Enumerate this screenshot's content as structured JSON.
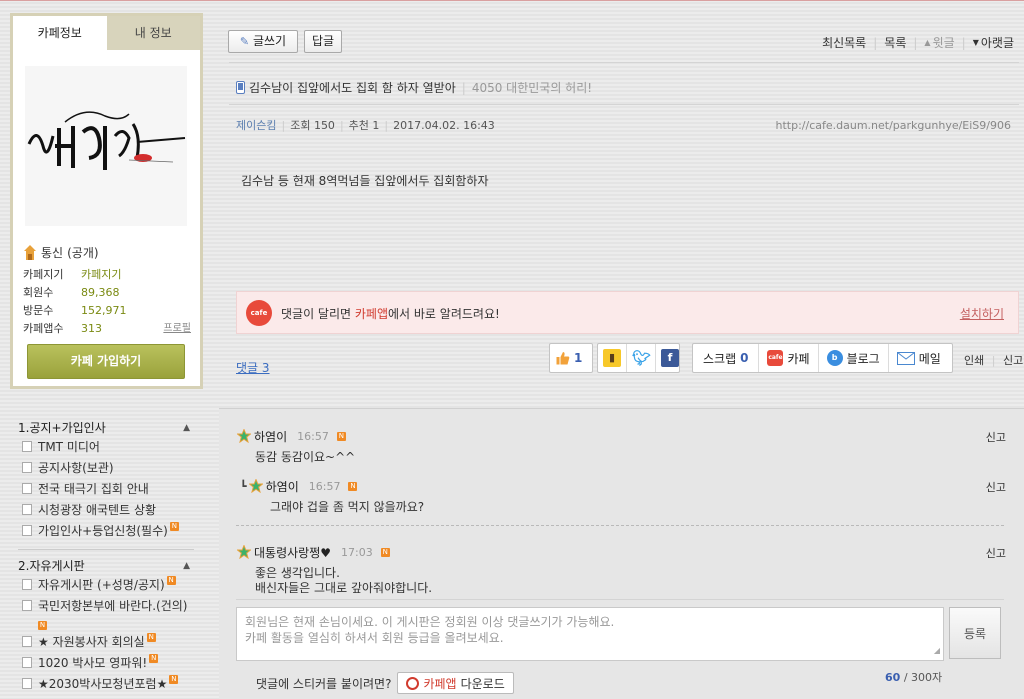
{
  "profile": {
    "tab_active": "카페정보",
    "tab_inactive": "내 정보",
    "level_name": "통신",
    "level_suffix": "(공개)",
    "stats": [
      {
        "key": "카페지기",
        "value": "카페지기"
      },
      {
        "key": "회원수",
        "value": "89,368"
      },
      {
        "key": "방문수",
        "value": "152,971"
      },
      {
        "key": "카페앱수",
        "value": "313",
        "link": "프로필"
      }
    ],
    "join_label": "카페 가입하기"
  },
  "menu": {
    "sections": [
      {
        "title": "1.공지+가입인사",
        "items": [
          {
            "label": "TMT 미디어",
            "new": false
          },
          {
            "label": "공지사항(보관)",
            "new": false
          },
          {
            "label": "전국 태극기 집회 안내",
            "new": false
          },
          {
            "label": "시청광장 애국텐트 상황",
            "new": false
          },
          {
            "label": "가입인사+등업신청(필수)",
            "new": true
          }
        ]
      },
      {
        "title": "2.자유게시판",
        "items": [
          {
            "label": "자유게시판 (+성명/공지)",
            "new": true
          },
          {
            "label": "국민저항본부에 바란다.(건의)",
            "new": true
          },
          {
            "label": "★ 자원봉사자 회의실",
            "new": true
          },
          {
            "label": "1020 박사모 영파워!",
            "new": true
          },
          {
            "label": "★2030박사모청년포럼★",
            "new": true
          }
        ]
      }
    ]
  },
  "toolbar": {
    "write_label": "글쓰기",
    "reply_label": "답글",
    "nav": [
      "최신목록",
      "목록",
      "윗글",
      "아랫글"
    ]
  },
  "post": {
    "title": "김수남이 집앞에서도 집회 함 하자 열받아",
    "board": "4050 대한민국의 허리!",
    "author": "제이슨킴",
    "views": "조회 150",
    "likes": "추천 1",
    "date": "2017.04.02. 16:43",
    "url": "http://cafe.daum.net/parkgunhye/EiS9/906",
    "content": "김수남 등 현재 8역먹넘들 집앞에서두 집회함하자"
  },
  "promo": {
    "icon_text": "cafe",
    "text_prefix": "댓글이 달리면 ",
    "text_highlight": "카페앱",
    "text_suffix": "에서 바로 알려드려요!",
    "install_label": "설치하기"
  },
  "share": {
    "comments_label": "댓글 3",
    "like_count": "1",
    "scrap_label": "스크랩",
    "scrap_count": "0",
    "cafe_label": "카페",
    "blog_label": "블로그",
    "mail_label": "메일",
    "print_label": "인쇄",
    "report_label": "신고"
  },
  "comments": [
    {
      "name": "하염이",
      "time": "16:57",
      "body": [
        "동감 동감이요~^^"
      ],
      "report": "신고"
    },
    {
      "name": "하염이",
      "time": "16:57",
      "body": [
        "그래야 겁을 좀 먹지 않을까요?"
      ],
      "report": "신고"
    },
    {
      "name": "대통령사랑쩡♥",
      "time": "17:03",
      "body": [
        "좋은 생각입니다.",
        "배신자들은 그대로 갚아줘야합니다."
      ],
      "report": "신고"
    }
  ],
  "comment_form": {
    "placeholder_line1": "회원님은 현재 손님이세요. 이 게시판은 정회원 이상 댓글쓰기가 가능해요.",
    "placeholder_line2": "카페 활동을 열심히 하셔서 회원 등급을 올려보세요.",
    "register_label": "등록",
    "sticker_prompt": "댓글에 스티커를 붙이려면?",
    "download_app": "카페앱",
    "download_label": "다운로드",
    "count_current": "60",
    "count_max": "/ 300자"
  },
  "colors": {
    "accent_green": "#9aa23b",
    "link_blue": "#3a6cc0",
    "new_badge": "#f08a24",
    "promo_red": "#e84a3b"
  }
}
